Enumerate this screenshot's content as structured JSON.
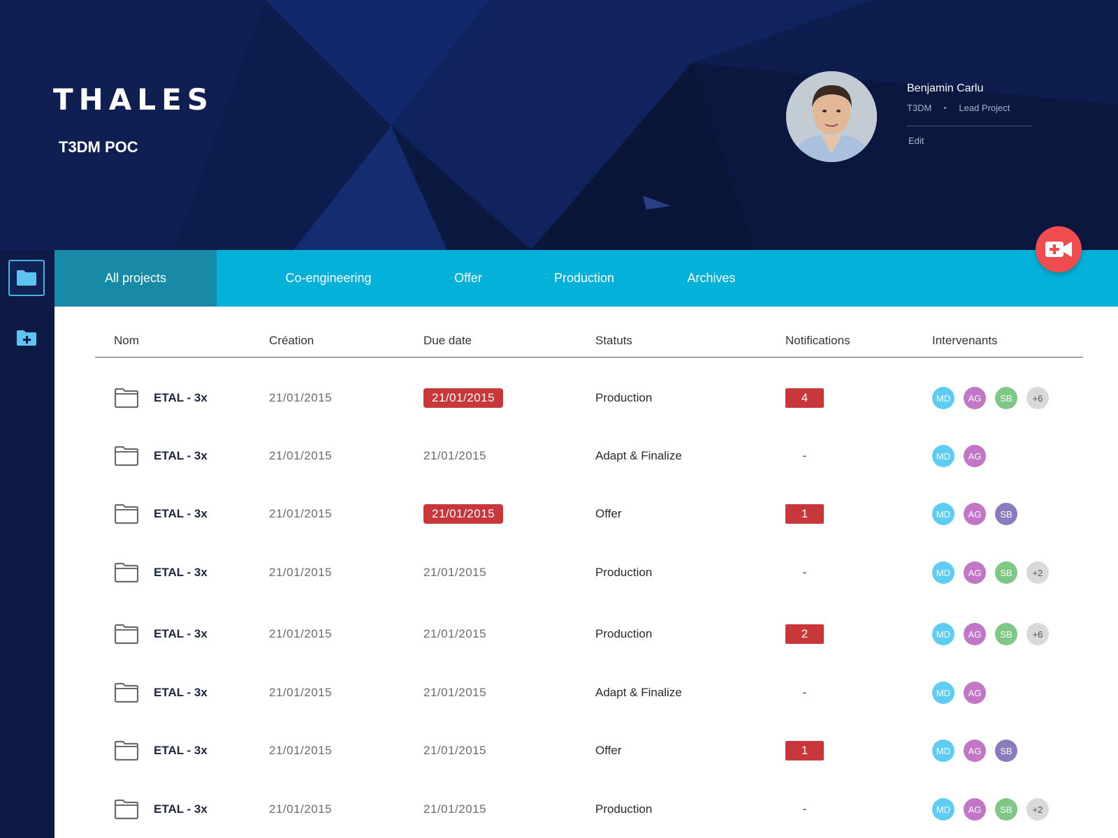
{
  "header": {
    "logo": "THALES",
    "project_name": "T3DM POC"
  },
  "user": {
    "name": "Benjamin Carlu",
    "company": "T3DM",
    "role": "Lead Project",
    "edit_label": "Edit"
  },
  "rail": {
    "items": [
      {
        "icon": "folder-icon",
        "active": true
      },
      {
        "icon": "folder-add-icon",
        "active": false
      }
    ]
  },
  "tabs": [
    {
      "label": "All projects",
      "active": true
    },
    {
      "label": "Co-engineering",
      "active": false
    },
    {
      "label": "Offer",
      "active": false
    },
    {
      "label": "Production",
      "active": false
    },
    {
      "label": "Archives",
      "active": false
    }
  ],
  "fab": {
    "icon": "video-add-icon"
  },
  "table": {
    "columns": [
      "Nom",
      "Création",
      "Due date",
      "Statuts",
      "Notifications",
      "Intervenants"
    ],
    "rows": [
      {
        "name": "ETAL - 3x",
        "creation": "21/01/2015",
        "due": "21/01/2015",
        "overdue": true,
        "status": "Production",
        "notifications": "4",
        "people": [
          "MD",
          "AG",
          "SB",
          "+6"
        ]
      },
      {
        "name": "ETAL - 3x",
        "creation": "21/01/2015",
        "due": "21/01/2015",
        "overdue": false,
        "status": "Adapt & Finalize",
        "notifications": "-",
        "people": [
          "MD",
          "AG"
        ]
      },
      {
        "name": "ETAL - 3x",
        "creation": "21/01/2015",
        "due": "21/01/2015",
        "overdue": true,
        "status": "Offer",
        "notifications": "1",
        "people": [
          "MD",
          "AG",
          "SB"
        ]
      },
      {
        "name": "ETAL - 3x",
        "creation": "21/01/2015",
        "due": "21/01/2015",
        "overdue": false,
        "status": "Production",
        "notifications": "-",
        "people": [
          "MD",
          "AG",
          "SB",
          "+2"
        ]
      },
      {
        "name": "ETAL - 3x",
        "creation": "21/01/2015",
        "due": "21/01/2015",
        "overdue": false,
        "status": "Production",
        "notifications": "2",
        "people": [
          "MD",
          "AG",
          "SB",
          "+6"
        ]
      },
      {
        "name": "ETAL - 3x",
        "creation": "21/01/2015",
        "due": "21/01/2015",
        "overdue": false,
        "status": "Adapt & Finalize",
        "notifications": "-",
        "people": [
          "MD",
          "AG"
        ]
      },
      {
        "name": "ETAL - 3x",
        "creation": "21/01/2015",
        "due": "21/01/2015",
        "overdue": false,
        "status": "Offer",
        "notifications": "1",
        "people": [
          "MD",
          "AG",
          "SB"
        ]
      },
      {
        "name": "ETAL - 3x",
        "creation": "21/01/2015",
        "due": "21/01/2015",
        "overdue": false,
        "status": "Production",
        "notifications": "-",
        "people": [
          "MD",
          "AG",
          "SB",
          "+2"
        ]
      }
    ]
  },
  "colors": {
    "header_bg": "#0c1a45",
    "tab_bar": "#04b2d9",
    "tab_active": "#168aa6",
    "alert_red": "#c8383a",
    "fab_red": "#ee4c4f",
    "chip_md": "#5fcdf3",
    "chip_ag": "#c177c6",
    "chip_sb_green": "#7ec785",
    "chip_sb_purple": "#8a7bbd",
    "chip_more": "#d9d9d9"
  }
}
